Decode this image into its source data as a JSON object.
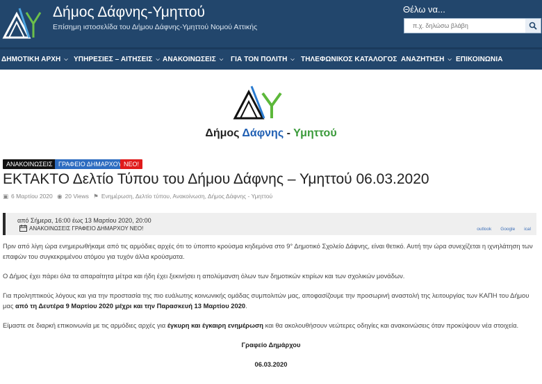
{
  "header": {
    "title": "Δήμος Δάφνης-Υμηττού",
    "subtitle": "Επίσημη ιστοσελίδα του Δήμου Δάφνης-Υμηττού Νομού Αττικής",
    "search_heading": "Θέλω να...",
    "search_placeholder": "π.χ. δηλώσω βλάβη"
  },
  "nav": {
    "items": [
      {
        "label": "ΔΗΜΟΤΙΚΗ ΑΡΧΗ",
        "dropdown": true
      },
      {
        "label": "ΥΠΗΡΕΣΙΕΣ – ΑΙΤΗΣΕΙΣ",
        "dropdown": true
      },
      {
        "label": "ΑΝΑΚΟΙΝΩΣΕΙΣ",
        "dropdown": true
      },
      {
        "label": "ΓΙΑ ΤΟΝ ΠΟΛΙΤΗ",
        "dropdown": true
      },
      {
        "label": "ΤΗΛΕΦΩΝΙΚΟΣ ΚΑΤΑΛΟΓΟΣ",
        "dropdown": false
      },
      {
        "label": "ΑΝΑΖΗΤΗΣΗ",
        "dropdown": true
      },
      {
        "label": "ΕΠΙΚΟΙΝΩΝΙΑ",
        "dropdown": false
      }
    ]
  },
  "brand": {
    "part1": "Δήμος ",
    "part2": "Δάφνης",
    "part3": " - ",
    "part4": "Υμηττού"
  },
  "tags": [
    "ΑΝΑΚΟΙΝΩΣΕΙΣ",
    "ΓΡΑΦΕΙΟ ΔΗΜΑΡΧΟΥ",
    "ΝΕΟ!"
  ],
  "post": {
    "title": "ΕΚΤΑΚΤΟ Δελτίο Τύπου του Δήμου Δάφνης – Υμηττού 06.03.2020",
    "date": "6 Μαρτίου 2020",
    "views": "20 Views",
    "keywords": "Ενημέρωση, Δελτίο τύπου, Ανακοίνωση, Δήμος Δάφνης - Υμηττού"
  },
  "event": {
    "time": "από Σήμερα, 16:00 έως 13 Μαρτίου 2020, 20:00",
    "categories": "ΑΝΑΚΟΙΝΩΣΕΙΣ ΓΡΑΦΕΙΟ ΔΗΜΑΡΧΟΥ ΝΕΟ!",
    "links": [
      "outlook",
      "Google",
      "ical"
    ]
  },
  "content": {
    "p1": "Πριν από λίγη ώρα ενημερωθήκαμε από τις αρμόδιες αρχές ότι το ύποπτο κρούσμα  κηδεμόνα στο 9° Δημοτικό Σχολείο Δάφνης, είναι θετικό. Αυτή την ώρα συνεχίζεται η ιχνηλάτηση των επαφών του συγκεκριμένου ατόμου για τυχόν άλλα κρούσματα.",
    "p2": "Ο Δήμος έχει πάρει όλα τα απαραίτητα μέτρα και ήδη έχει ξεκινήσει η απολύμανση όλων των δημοτικών κτιρίων και των σχολικών μονάδων.",
    "p3_a": "Για προληπτικούς λόγους και για την προστασία της πιο ευάλωτης κοινωνικής ομάδας συμπολιτών μας, αποφασίζουμε την προσωρινή αναστολή της λειτουργίας των ΚΑΠΗ του Δήμου μας ",
    "p3_b": "από τη Δευτέρα 9 Μαρτίου 2020 μέχρι και την Παρασκευή 13 Μαρτίου 2020",
    "p3_c": ".",
    "p4_a": "Είμαστε σε διαρκή επικοινωνία με τις αρμόδιες αρχές για ",
    "p4_b": "έγκυρη και έγκαιρη ενημέρωση",
    "p4_c": " και θα ακολουθήσουν νεώτερες οδηγίες και ανακοινώσεις όταν προκύψουν νέα στοιχεία.",
    "signature": "Γραφείο Δημάρχου",
    "sign_date": "06.03.2020"
  },
  "colors": {
    "header_bg": "#22466c",
    "accent_blue": "#2d6cc0",
    "accent_red": "#e01b1b",
    "brand_green": "#3a9a3a"
  }
}
